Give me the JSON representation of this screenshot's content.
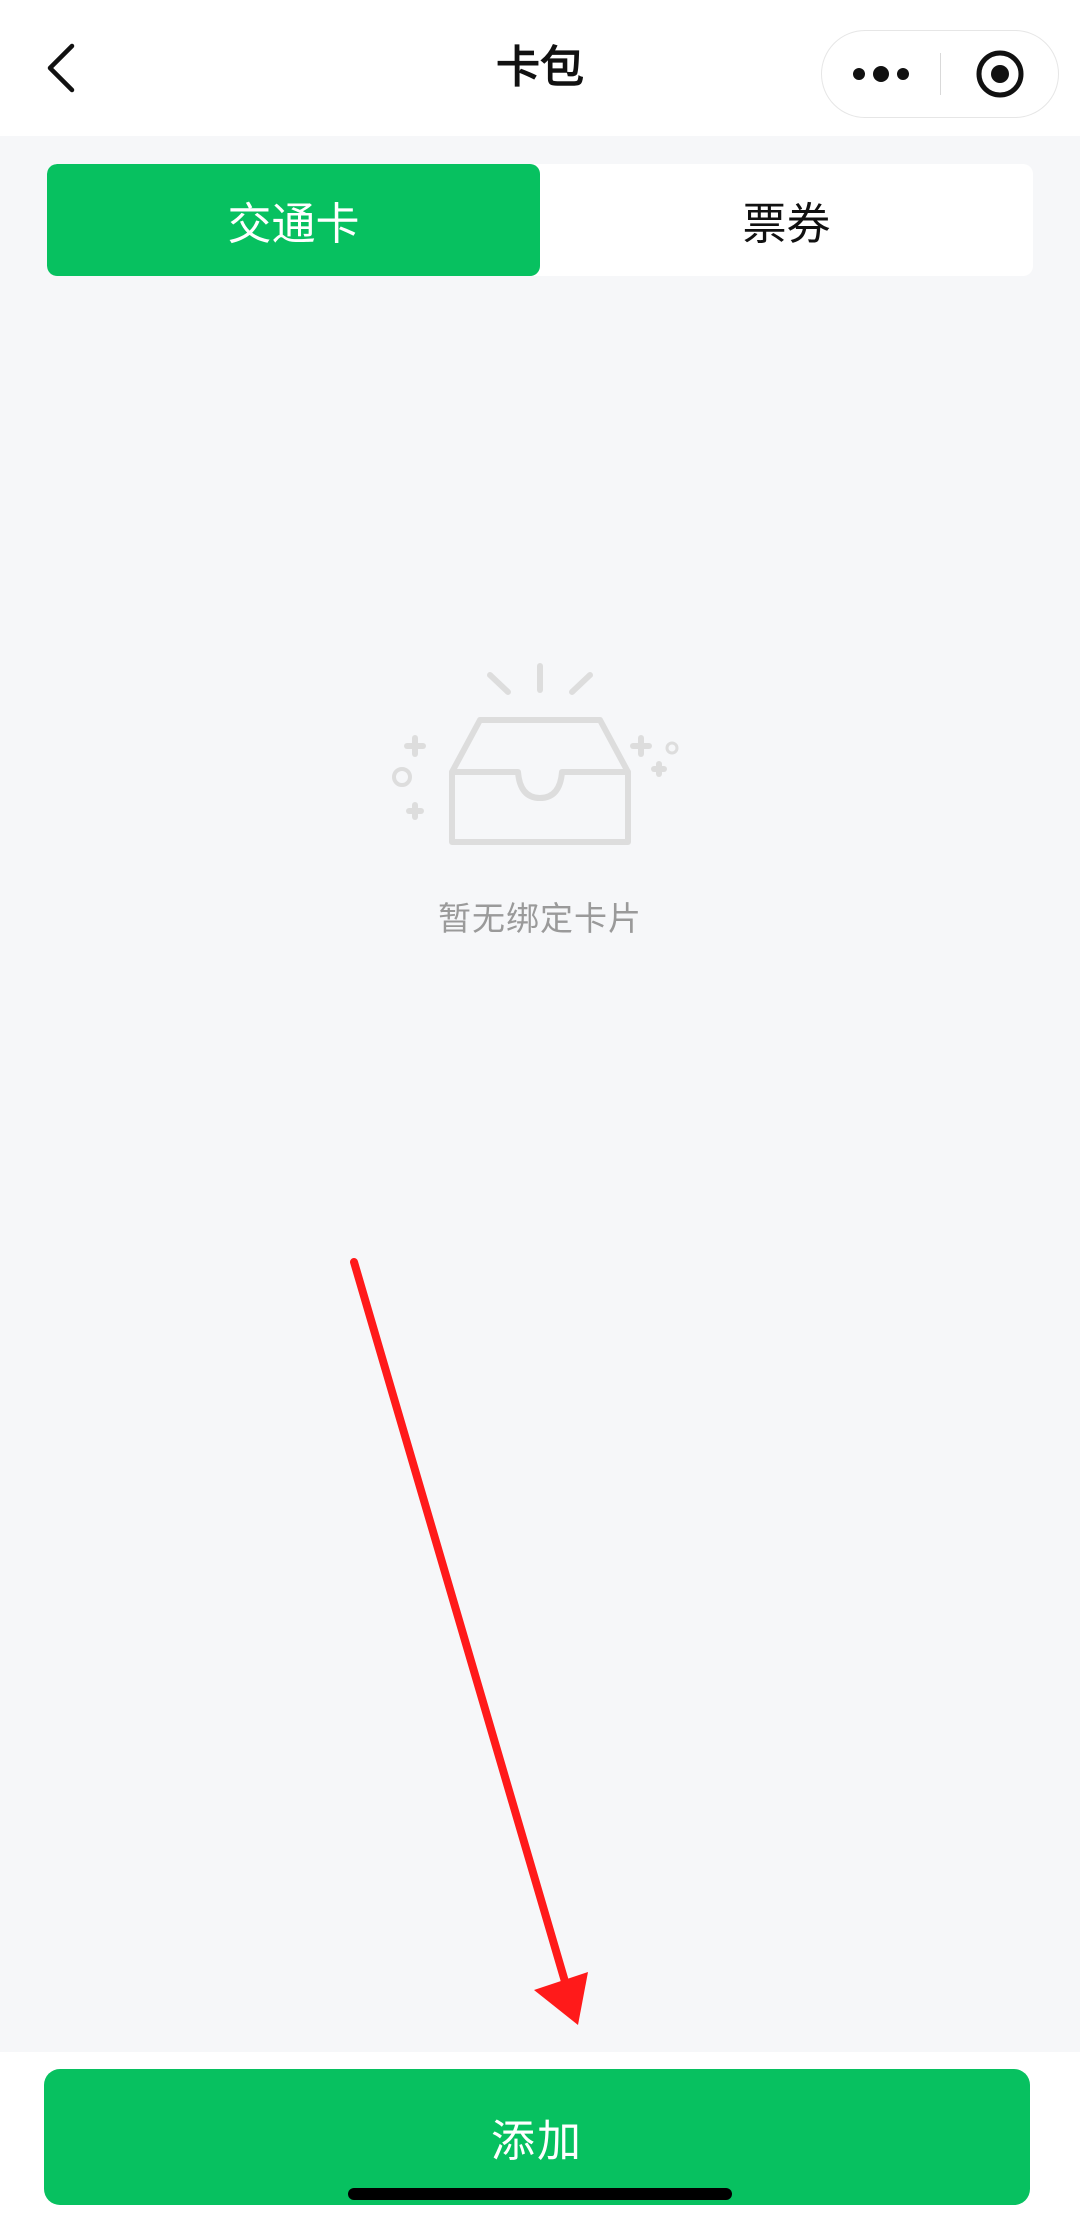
{
  "header": {
    "title": "卡包",
    "back_icon": "back-chevron-icon",
    "more_icon": "more-dots-icon",
    "close_icon": "close-target-icon"
  },
  "tabs": [
    {
      "label": "交通卡",
      "active": true
    },
    {
      "label": "票券",
      "active": false
    }
  ],
  "empty_state": {
    "icon": "empty-box-icon",
    "message": "暂无绑定卡片"
  },
  "footer": {
    "add_label": "添加"
  },
  "colors": {
    "accent": "#07c160",
    "background": "#f6f7f9",
    "annotation_arrow": "#ff1a1a"
  }
}
